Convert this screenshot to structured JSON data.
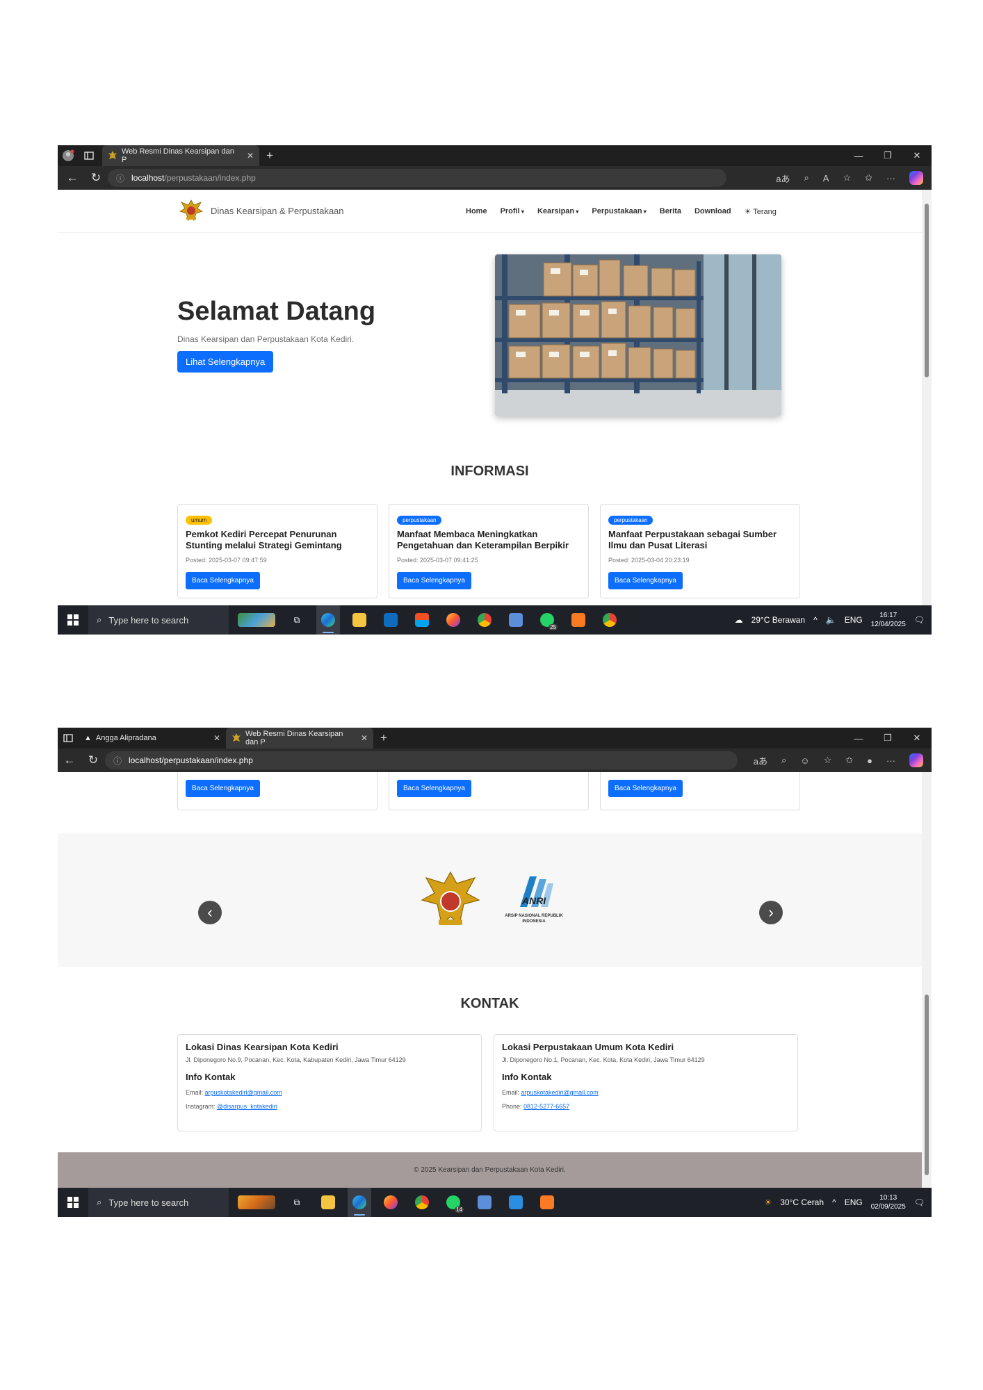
{
  "shot1": {
    "browser": {
      "tab_title": "Web Resmi Dinas Kearsipan dan P",
      "url_host": "localhost",
      "url_path": "/perpustakaan/index.php"
    },
    "site": {
      "brand": "Dinas Kearsipan & Perpustakaan",
      "menu": [
        "Home",
        "Profil",
        "Kearsipan",
        "Perpustakaan",
        "Berita",
        "Download",
        "☀ Terang"
      ],
      "hero_title": "Selamat Datang",
      "hero_subtitle": "Dinas Kearsipan dan Perpustakaan Kota Kediri.",
      "hero_button": "Lihat Selengkapnya",
      "info_title": "INFORMASI",
      "cards": [
        {
          "badge": "umum",
          "title": "Pemkot Kediri Percepat Penurunan Stunting melalui Strategi Gemintang",
          "posted": "Posted: 2025-03-07 09:47:59",
          "button": "Baca Selengkapnya"
        },
        {
          "badge": "perpustakaan",
          "title": "Manfaat Membaca Meningkatkan Pengetahuan dan Keterampilan Berpikir",
          "posted": "Posted: 2025-03-07 09:41:25",
          "button": "Baca Selengkapnya"
        },
        {
          "badge": "perpustakaan",
          "title": "Manfaat Perpustakaan sebagai Sumber Ilmu dan Pusat Literasi",
          "posted": "Posted: 2025-03-04 20:23:19",
          "button": "Baca Selengkapnya"
        }
      ]
    },
    "taskbar": {
      "search_placeholder": "Type here to search",
      "weather": "29°C  Berawan",
      "lang": "ENG",
      "time": "16:17",
      "date": "12/04/2025",
      "whatsapp_count": "25"
    }
  },
  "shot2": {
    "browser": {
      "tab1_title": "Angga Alipradana",
      "tab2_title": "Web Resmi Dinas Kearsipan dan P",
      "url": "localhost/perpustakaan/index.php"
    },
    "site": {
      "buttons": [
        "Baca Selengkapnya",
        "Baca Selengkapnya",
        "Baca Selengkapnya"
      ],
      "anri_label": "ANRI",
      "anri_sub": "ARSIP NASIONAL REPUBLIK INDONESIA",
      "contact_title": "KONTAK",
      "contacts": [
        {
          "title": "Lokasi Dinas Kearsipan Kota Kediri",
          "address": "Jl. Diponegoro No.9, Pocanan, Kec. Kota, Kabupaten Kediri, Jawa Timur 64129",
          "info_title": "Info Kontak",
          "line1_label": "Email: ",
          "line1_value": "arpuskotakediri@gmail.com",
          "line2_label": "Instagram: ",
          "line2_value": "@disarpus_kotakediri"
        },
        {
          "title": "Lokasi Perpustakaan Umum Kota Kediri",
          "address": "Jl. Diponegoro No.1, Pocanan, Kec. Kota, Kota Kediri, Jawa Timur 64129",
          "info_title": "Info Kontak",
          "line1_label": "Email: ",
          "line1_value": "arpuskotakediri@gmail.com",
          "line2_label": "Phone: ",
          "line2_value": "0812-5277-6657"
        }
      ],
      "footer": "© 2025 Kearsipan dan Perpustakaan Kota Kediri."
    },
    "taskbar": {
      "search_placeholder": "Type here to search",
      "weather": "30°C  Cerah",
      "lang": "ENG",
      "time": "10:13",
      "date": "02/09/2025",
      "whatsapp_count": "14"
    }
  },
  "colors": {
    "primary": "#0d6efd",
    "warning": "#ffc107",
    "footer": "#a69b9b",
    "taskbar": "#1e2128"
  }
}
